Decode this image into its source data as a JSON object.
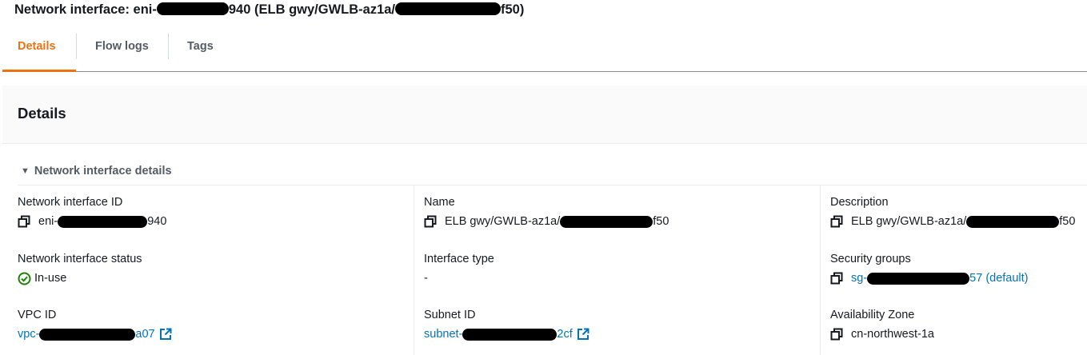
{
  "page": {
    "title_prefix": "Network interface: eni-",
    "title_suffix": "940 (ELB gwy/GWLB-az1a/",
    "title_end": "f50)"
  },
  "tabs": [
    {
      "label": "Details",
      "active": true
    },
    {
      "label": "Flow logs",
      "active": false
    },
    {
      "label": "Tags",
      "active": false
    }
  ],
  "panel": {
    "title": "Details",
    "section_label": "Network interface details"
  },
  "fields": {
    "eni_id": {
      "label": "Network interface ID",
      "prefix": "eni-",
      "suffix": "940"
    },
    "name": {
      "label": "Name",
      "prefix": "ELB gwy/GWLB-az1a/",
      "suffix": "f50"
    },
    "description": {
      "label": "Description",
      "prefix": "ELB gwy/GWLB-az1a/",
      "suffix": "f50"
    },
    "status": {
      "label": "Network interface status",
      "value": "In-use"
    },
    "interface_type": {
      "label": "Interface type",
      "value": "-"
    },
    "security_groups": {
      "label": "Security groups",
      "prefix": "sg-",
      "suffix": "57 (default)"
    },
    "vpc_id": {
      "label": "VPC ID",
      "prefix": "vpc-",
      "suffix": "a07"
    },
    "subnet_id": {
      "label": "Subnet ID",
      "prefix": "subnet-",
      "suffix": "2cf"
    },
    "availability_zone": {
      "label": "Availability Zone",
      "value": "cn-northwest-1a"
    }
  },
  "colors": {
    "accent": "#ec7211",
    "link": "#0073bb",
    "success": "#1d8102",
    "text": "#16191f",
    "muted": "#545b64"
  },
  "icons": [
    "copy-icon",
    "external-link-icon",
    "status-ok-icon",
    "caret-down-icon"
  ]
}
